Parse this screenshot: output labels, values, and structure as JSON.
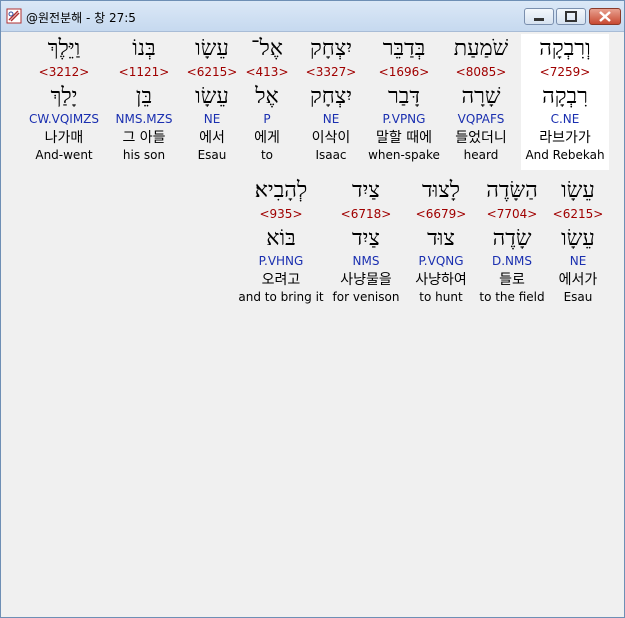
{
  "window": {
    "title": "@원전분해 - 창 27:5",
    "icon": "bible-app-icon"
  },
  "verse": {
    "line1": [
      {
        "heb": "וְרִבְקָה",
        "strong": "<7259>",
        "lemma": "רִבְקָה",
        "parse": "C.NE",
        "kor": "라브가가",
        "eng": "And Rebekah",
        "highlighted": true
      },
      {
        "heb": "שֹׁמַעַת",
        "strong": "<8085>",
        "lemma": "שָׁרָה",
        "parse": "VQPAFS",
        "kor": "들었더니",
        "eng": "heard",
        "highlighted": false
      },
      {
        "heb": "בְּדַבֵּר",
        "strong": "<1696>",
        "lemma": "דָּבַר",
        "parse": "P.VPNG",
        "kor": "말할 때에",
        "eng": "when-spake",
        "highlighted": false
      },
      {
        "heb": "יִצְחָק",
        "strong": "<3327>",
        "lemma": "יִצְחָק",
        "parse": "NE",
        "kor": "이삭이",
        "eng": "Isaac",
        "highlighted": false
      },
      {
        "heb": "אֶל־",
        "strong": "<413>",
        "lemma": "אֶל",
        "parse": "P",
        "kor": "에게",
        "eng": "to",
        "highlighted": false
      },
      {
        "heb": "עֵשָׂו",
        "strong": "<6215>",
        "lemma": "עֵשָׂו",
        "parse": "NE",
        "kor": "에서",
        "eng": "Esau",
        "highlighted": false
      },
      {
        "heb": "בְּנוֹ",
        "strong": "<1121>",
        "lemma": "בֵּן",
        "parse": "NMS.MZS",
        "kor": "그 아들",
        "eng": "his son",
        "highlighted": false
      },
      {
        "heb": "וַיֵּלֶךְ",
        "strong": "<3212>",
        "lemma": "יָלַךְ",
        "parse": "CW.VQIMZS",
        "kor": "나가매",
        "eng": "And-went",
        "highlighted": false
      }
    ],
    "line2": [
      {
        "heb": "עֵשָׂו",
        "strong": "<6215>",
        "lemma": "עֵשָׂו",
        "parse": "NE",
        "kor": "에서가",
        "eng": "Esau",
        "highlighted": false
      },
      {
        "heb": "הַשָּׂדֶה",
        "strong": "<7704>",
        "lemma": "שָׂדֶה",
        "parse": "D.NMS",
        "kor": "들로",
        "eng": "to the field",
        "highlighted": false
      },
      {
        "heb": "לָצוּד",
        "strong": "<6679>",
        "lemma": "צוּד",
        "parse": "P.VQNG",
        "kor": "사냥하여",
        "eng": "to hunt",
        "highlighted": false
      },
      {
        "heb": "צַיִד",
        "strong": "<6718>",
        "lemma": "צַיִד",
        "parse": "NMS",
        "kor": "사냥물을",
        "eng": "for venison",
        "highlighted": false
      },
      {
        "heb": "לְהָבִיא׃",
        "strong": "<935>",
        "lemma": "בּוֹא",
        "parse": "P.VHNG",
        "kor": "오려고",
        "eng": "and to bring it",
        "highlighted": false
      }
    ]
  },
  "colors": {
    "strong": "#a00000",
    "parse": "#1a2fb0",
    "highlight": "#ffffff",
    "background": "#f0f0f0"
  }
}
